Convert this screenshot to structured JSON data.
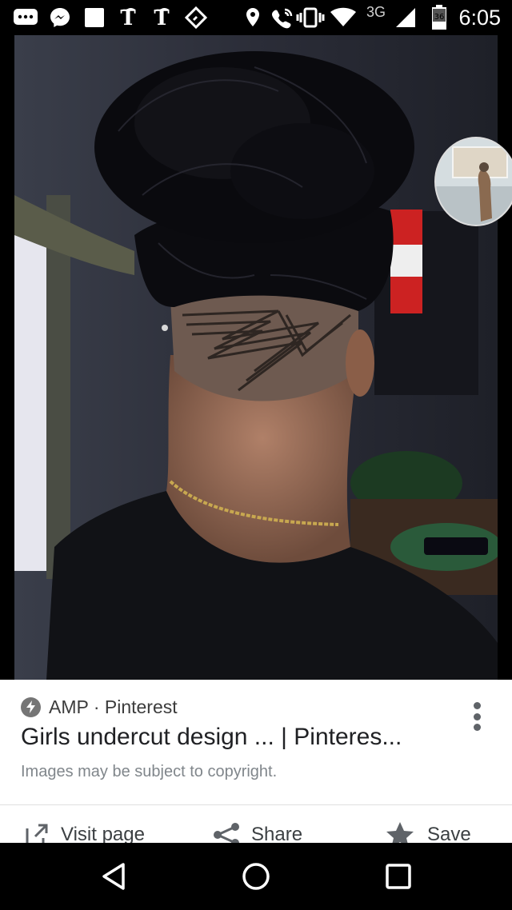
{
  "status_bar": {
    "time": "6:05",
    "network": "3G",
    "battery_level": "36",
    "icons": [
      "messages-icon",
      "messenger-icon",
      "square-notification-icon",
      "nyt-icon",
      "nyt-icon",
      "tag-icon",
      "location-icon",
      "wifi-call-icon",
      "vibrate-icon",
      "wifi-icon",
      "cell-signal-icon",
      "battery-icon"
    ]
  },
  "image": {
    "subject": "photo",
    "pip_subject": "floating video thumbnail"
  },
  "result": {
    "source": "AMP · Pinterest",
    "title": "Girls undercut design ... | Pinteres...",
    "copyright": "Images may be subject to copyright."
  },
  "actions": {
    "visit_page": "Visit page",
    "share": "Share",
    "save": "Save"
  },
  "colors": {
    "accent_text": "#202124",
    "secondary_text": "#80868b",
    "status_bar": "#000000"
  }
}
